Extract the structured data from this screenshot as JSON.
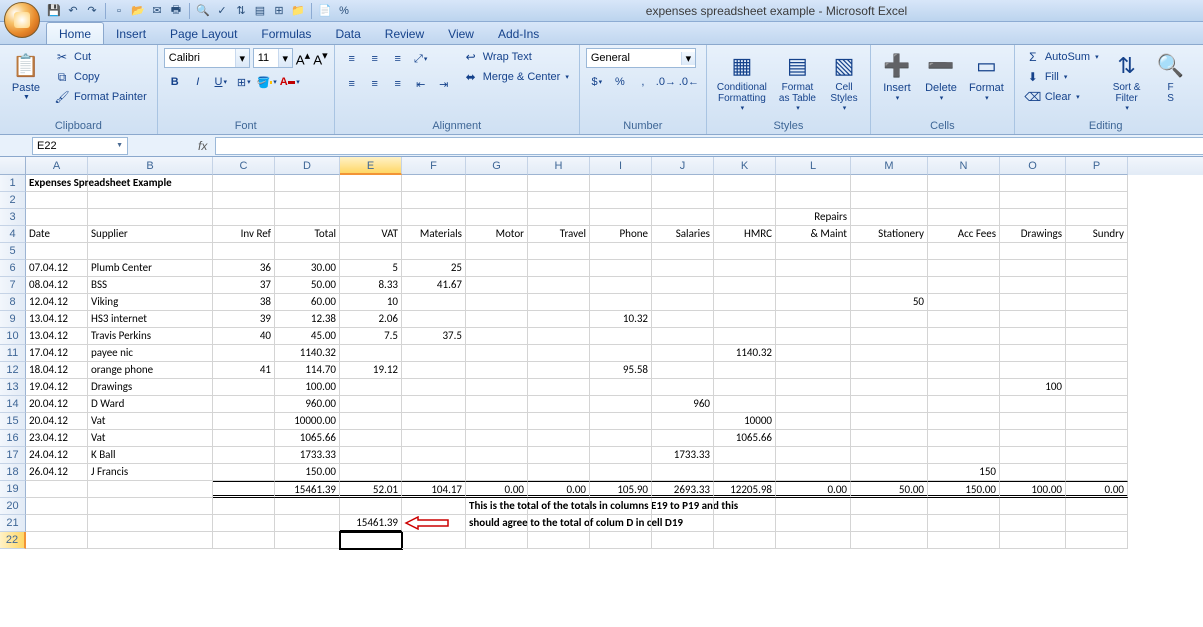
{
  "app_title": "expenses spreadsheet example - Microsoft Excel",
  "qat": [
    {
      "name": "save-icon",
      "glyph": "💾"
    },
    {
      "name": "undo-icon",
      "glyph": "↶"
    },
    {
      "name": "redo-icon",
      "glyph": "↷"
    },
    {
      "name": "new-icon",
      "glyph": "▫"
    },
    {
      "name": "open-icon",
      "glyph": "📂"
    },
    {
      "name": "mail-icon",
      "glyph": "✉"
    },
    {
      "name": "print-icon",
      "glyph": "🖶"
    },
    {
      "name": "preview-icon",
      "glyph": "🔍"
    },
    {
      "name": "spell-icon",
      "glyph": "✓"
    },
    {
      "name": "sort-icon",
      "glyph": "⇅"
    },
    {
      "name": "form-icon",
      "glyph": "▤"
    },
    {
      "name": "table-icon",
      "glyph": "⊞"
    },
    {
      "name": "folder-icon",
      "glyph": "📁"
    },
    {
      "name": "page-icon",
      "glyph": "📄"
    },
    {
      "name": "percent-icon",
      "glyph": "%"
    }
  ],
  "tabs": [
    {
      "label": "Home",
      "active": true
    },
    {
      "label": "Insert"
    },
    {
      "label": "Page Layout"
    },
    {
      "label": "Formulas"
    },
    {
      "label": "Data"
    },
    {
      "label": "Review"
    },
    {
      "label": "View"
    },
    {
      "label": "Add-Ins"
    }
  ],
  "ribbon": {
    "clipboard": {
      "title": "Clipboard",
      "paste": "Paste",
      "cut": "Cut",
      "copy": "Copy",
      "format_painter": "Format Painter"
    },
    "font": {
      "title": "Font",
      "name": "Calibri",
      "size": "11"
    },
    "alignment": {
      "title": "Alignment",
      "wrap": "Wrap Text",
      "merge": "Merge & Center"
    },
    "number": {
      "title": "Number",
      "format": "General"
    },
    "styles": {
      "title": "Styles",
      "cond": "Conditional\nFormatting",
      "table": "Format\nas Table",
      "cell": "Cell\nStyles"
    },
    "cells": {
      "title": "Cells",
      "insert": "Insert",
      "delete": "Delete",
      "format": "Format"
    },
    "editing": {
      "title": "Editing",
      "autosum": "AutoSum",
      "fill": "Fill",
      "clear": "Clear",
      "sort": "Sort &\nFilter",
      "find": "F\nS"
    }
  },
  "namebox": "E22",
  "formula": "",
  "columns": [
    "A",
    "B",
    "C",
    "D",
    "E",
    "F",
    "G",
    "H",
    "I",
    "J",
    "K",
    "L",
    "M",
    "N",
    "O",
    "P"
  ],
  "headers_row3": {
    "L": "Repairs"
  },
  "headers_row4": {
    "A": "Date",
    "B": "Supplier",
    "C": "Inv Ref",
    "D": "Total",
    "E": "VAT",
    "F": "Materials",
    "G": "Motor",
    "H": "Travel",
    "I": "Phone",
    "J": "Salaries",
    "K": "HMRC",
    "L": "& Maint",
    "M": "Stationery",
    "N": "Acc Fees",
    "O": "Drawings",
    "P": "Sundry"
  },
  "title_cell": "Expenses Spreadsheet Example",
  "rows": [
    {
      "n": 6,
      "A": "07.04.12",
      "B": "Plumb Center",
      "C": "36",
      "D": "30.00",
      "E": "5",
      "F": "25"
    },
    {
      "n": 7,
      "A": "08.04.12",
      "B": "BSS",
      "C": "37",
      "D": "50.00",
      "E": "8.33",
      "F": "41.67"
    },
    {
      "n": 8,
      "A": "12.04.12",
      "B": "Viking",
      "C": "38",
      "D": "60.00",
      "E": "10",
      "M": "50"
    },
    {
      "n": 9,
      "A": "13.04.12",
      "B": "HS3 internet",
      "C": "39",
      "D": "12.38",
      "E": "2.06",
      "I": "10.32"
    },
    {
      "n": 10,
      "A": "13.04.12",
      "B": "Travis Perkins",
      "C": "40",
      "D": "45.00",
      "E": "7.5",
      "F": "37.5"
    },
    {
      "n": 11,
      "A": "17.04.12",
      "B": "payee nic",
      "D": "1140.32",
      "K": "1140.32"
    },
    {
      "n": 12,
      "A": "18.04.12",
      "B": "orange phone",
      "C": "41",
      "D": "114.70",
      "E": "19.12",
      "I": "95.58"
    },
    {
      "n": 13,
      "A": "19.04.12",
      "B": "Drawings",
      "D": "100.00",
      "O": "100"
    },
    {
      "n": 14,
      "A": "20.04.12",
      "B": "D Ward",
      "D": "960.00",
      "J": "960"
    },
    {
      "n": 15,
      "A": "20.04.12",
      "B": "Vat",
      "D": "10000.00",
      "K": "10000"
    },
    {
      "n": 16,
      "A": "23.04.12",
      "B": "Vat",
      "D": "1065.66",
      "K": "1065.66"
    },
    {
      "n": 17,
      "A": "24.04.12",
      "B": "K Ball",
      "D": "1733.33",
      "J": "1733.33"
    },
    {
      "n": 18,
      "A": "26.04.12",
      "B": "J Francis",
      "D": "150.00",
      "N": "150"
    }
  ],
  "totals": {
    "n": 19,
    "D": "15461.39",
    "E": "52.01",
    "F": "104.17",
    "G": "0.00",
    "H": "0.00",
    "I": "105.90",
    "J": "2693.33",
    "K": "12205.98",
    "L": "0.00",
    "M": "50.00",
    "N": "150.00",
    "O": "100.00",
    "P": "0.00"
  },
  "check_row": {
    "n": 21,
    "E": "15461.39"
  },
  "annotation": {
    "line1": "This is the total of the totals in columns E19 to P19 and this",
    "line2": "should agree to the total of colum D in cell D19"
  },
  "selected_cell": "E22"
}
